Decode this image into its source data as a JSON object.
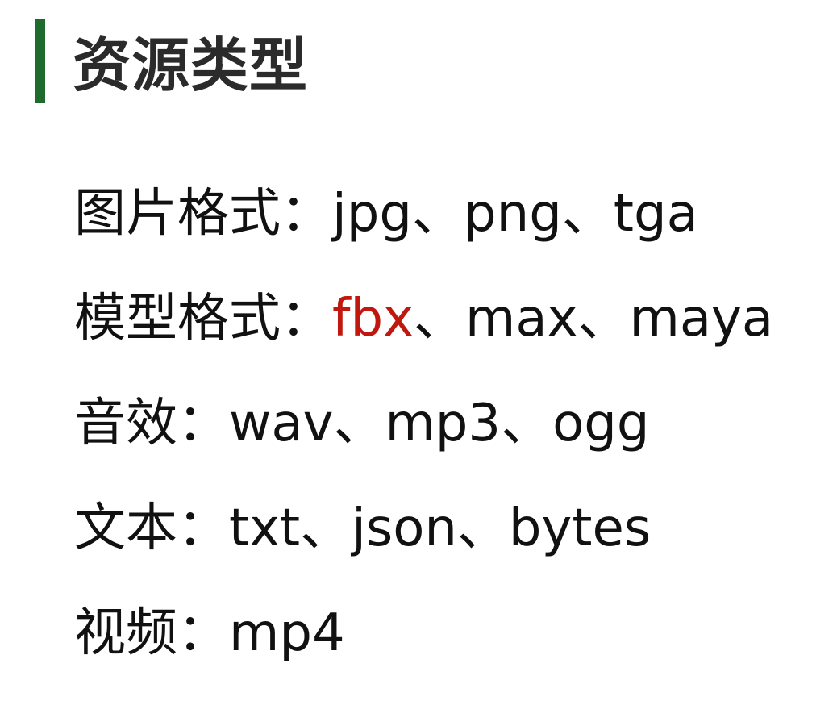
{
  "title": "资源类型",
  "accent_color": "#1f6b2e",
  "highlight_color": "#c0170f",
  "separator": "、",
  "lines": [
    {
      "label": "图片格式：",
      "formats": [
        {
          "text": "jpg",
          "highlight": false
        },
        {
          "text": "png",
          "highlight": false
        },
        {
          "text": "tga",
          "highlight": false
        }
      ]
    },
    {
      "label": "模型格式：",
      "formats": [
        {
          "text": "fbx",
          "highlight": true
        },
        {
          "text": "max",
          "highlight": false
        },
        {
          "text": "maya",
          "highlight": false
        }
      ]
    },
    {
      "label": "音效：",
      "formats": [
        {
          "text": "wav",
          "highlight": false
        },
        {
          "text": "mp3",
          "highlight": false
        },
        {
          "text": "ogg",
          "highlight": false
        }
      ]
    },
    {
      "label": "文本：",
      "formats": [
        {
          "text": "txt",
          "highlight": false
        },
        {
          "text": "json",
          "highlight": false
        },
        {
          "text": "bytes",
          "highlight": false
        }
      ]
    },
    {
      "label": "视频：",
      "formats": [
        {
          "text": "mp4",
          "highlight": false
        }
      ]
    }
  ]
}
